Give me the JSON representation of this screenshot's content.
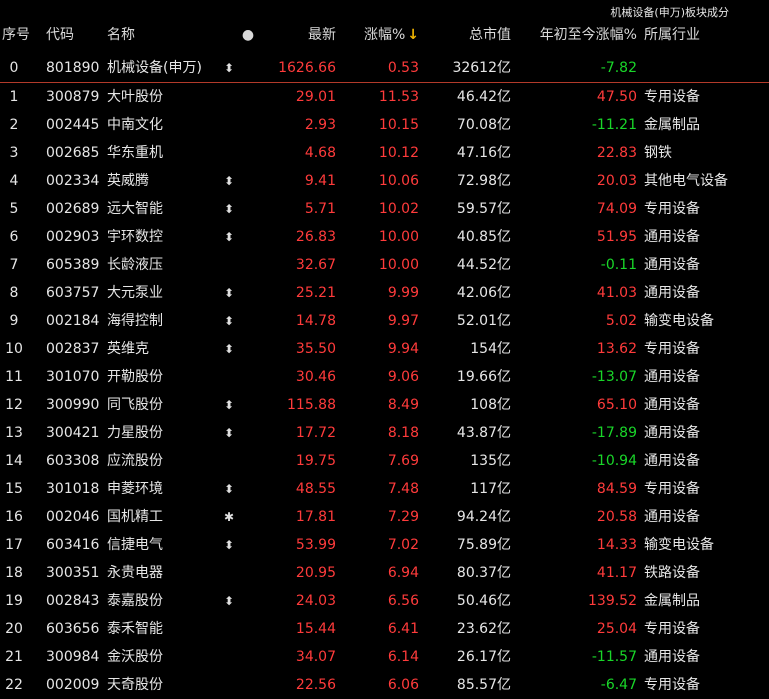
{
  "title": "机械设备(申万)板块成分",
  "header": {
    "seq": "序号",
    "code": "代码",
    "name": "名称",
    "dot": "●",
    "last": "最新",
    "chg": "涨幅%",
    "sort_arrow": "↓",
    "cap": "总市值",
    "ytd": "年初至今涨幅%",
    "industry": "所属行业"
  },
  "colors": {
    "up": "#ff3b3b",
    "down": "#19d629",
    "sort_arrow": "#f0b400",
    "index_divider": "#b33a2a"
  },
  "rows": [
    {
      "seq": "0",
      "code": "801890",
      "name": "机械设备(申万)",
      "flag": "⬍",
      "last": "1626.66",
      "chg": "0.53",
      "cap": "32612亿",
      "ytd": "-7.82",
      "industry": "",
      "last_dir": "up",
      "ytd_dir": "down",
      "is_index": true
    },
    {
      "seq": "1",
      "code": "300879",
      "name": "大叶股份",
      "flag": "",
      "last": "29.01",
      "chg": "11.53",
      "cap": "46.42亿",
      "ytd": "47.50",
      "industry": "专用设备",
      "last_dir": "up",
      "ytd_dir": "up"
    },
    {
      "seq": "2",
      "code": "002445",
      "name": "中南文化",
      "flag": "",
      "last": "2.93",
      "chg": "10.15",
      "cap": "70.08亿",
      "ytd": "-11.21",
      "industry": "金属制品",
      "last_dir": "up",
      "ytd_dir": "down"
    },
    {
      "seq": "3",
      "code": "002685",
      "name": "华东重机",
      "flag": "",
      "last": "4.68",
      "chg": "10.12",
      "cap": "47.16亿",
      "ytd": "22.83",
      "industry": "钢铁",
      "last_dir": "up",
      "ytd_dir": "up"
    },
    {
      "seq": "4",
      "code": "002334",
      "name": "英威腾",
      "flag": "⬍",
      "last": "9.41",
      "chg": "10.06",
      "cap": "72.98亿",
      "ytd": "20.03",
      "industry": "其他电气设备",
      "last_dir": "up",
      "ytd_dir": "up"
    },
    {
      "seq": "5",
      "code": "002689",
      "name": "远大智能",
      "flag": "⬍",
      "last": "5.71",
      "chg": "10.02",
      "cap": "59.57亿",
      "ytd": "74.09",
      "industry": "专用设备",
      "last_dir": "up",
      "ytd_dir": "up"
    },
    {
      "seq": "6",
      "code": "002903",
      "name": "宇环数控",
      "flag": "⬍",
      "last": "26.83",
      "chg": "10.00",
      "cap": "40.85亿",
      "ytd": "51.95",
      "industry": "通用设备",
      "last_dir": "up",
      "ytd_dir": "up"
    },
    {
      "seq": "7",
      "code": "605389",
      "name": "长龄液压",
      "flag": "",
      "last": "32.67",
      "chg": "10.00",
      "cap": "44.52亿",
      "ytd": "-0.11",
      "industry": "通用设备",
      "last_dir": "up",
      "ytd_dir": "down"
    },
    {
      "seq": "8",
      "code": "603757",
      "name": "大元泵业",
      "flag": "⬍",
      "last": "25.21",
      "chg": "9.99",
      "cap": "42.06亿",
      "ytd": "41.03",
      "industry": "通用设备",
      "last_dir": "up",
      "ytd_dir": "up"
    },
    {
      "seq": "9",
      "code": "002184",
      "name": "海得控制",
      "flag": "⬍",
      "last": "14.78",
      "chg": "9.97",
      "cap": "52.01亿",
      "ytd": "5.02",
      "industry": "输变电设备",
      "last_dir": "up",
      "ytd_dir": "up"
    },
    {
      "seq": "10",
      "code": "002837",
      "name": "英维克",
      "flag": "⬍",
      "last": "35.50",
      "chg": "9.94",
      "cap": "154亿",
      "ytd": "13.62",
      "industry": "专用设备",
      "last_dir": "up",
      "ytd_dir": "up"
    },
    {
      "seq": "11",
      "code": "301070",
      "name": "开勒股份",
      "flag": "",
      "last": "30.46",
      "chg": "9.06",
      "cap": "19.66亿",
      "ytd": "-13.07",
      "industry": "通用设备",
      "last_dir": "up",
      "ytd_dir": "down"
    },
    {
      "seq": "12",
      "code": "300990",
      "name": "同飞股份",
      "flag": "⬍",
      "last": "115.88",
      "chg": "8.49",
      "cap": "108亿",
      "ytd": "65.10",
      "industry": "通用设备",
      "last_dir": "up",
      "ytd_dir": "up"
    },
    {
      "seq": "13",
      "code": "300421",
      "name": "力星股份",
      "flag": "⬍",
      "last": "17.72",
      "chg": "8.18",
      "cap": "43.87亿",
      "ytd": "-17.89",
      "industry": "通用设备",
      "last_dir": "up",
      "ytd_dir": "down"
    },
    {
      "seq": "14",
      "code": "603308",
      "name": "应流股份",
      "flag": "",
      "last": "19.75",
      "chg": "7.69",
      "cap": "135亿",
      "ytd": "-10.94",
      "industry": "通用设备",
      "last_dir": "up",
      "ytd_dir": "down"
    },
    {
      "seq": "15",
      "code": "301018",
      "name": "申菱环境",
      "flag": "⬍",
      "last": "48.55",
      "chg": "7.48",
      "cap": "117亿",
      "ytd": "84.59",
      "industry": "专用设备",
      "last_dir": "up",
      "ytd_dir": "up"
    },
    {
      "seq": "16",
      "code": "002046",
      "name": "国机精工",
      "flag": "✱",
      "last": "17.81",
      "chg": "7.29",
      "cap": "94.24亿",
      "ytd": "20.58",
      "industry": "通用设备",
      "last_dir": "up",
      "ytd_dir": "up"
    },
    {
      "seq": "17",
      "code": "603416",
      "name": "信捷电气",
      "flag": "⬍",
      "last": "53.99",
      "chg": "7.02",
      "cap": "75.89亿",
      "ytd": "14.33",
      "industry": "输变电设备",
      "last_dir": "up",
      "ytd_dir": "up"
    },
    {
      "seq": "18",
      "code": "300351",
      "name": "永贵电器",
      "flag": "",
      "last": "20.95",
      "chg": "6.94",
      "cap": "80.37亿",
      "ytd": "41.17",
      "industry": "铁路设备",
      "last_dir": "up",
      "ytd_dir": "up"
    },
    {
      "seq": "19",
      "code": "002843",
      "name": "泰嘉股份",
      "flag": "⬍",
      "last": "24.03",
      "chg": "6.56",
      "cap": "50.46亿",
      "ytd": "139.52",
      "industry": "金属制品",
      "last_dir": "up",
      "ytd_dir": "up"
    },
    {
      "seq": "20",
      "code": "603656",
      "name": "泰禾智能",
      "flag": "",
      "last": "15.44",
      "chg": "6.41",
      "cap": "23.62亿",
      "ytd": "25.04",
      "industry": "专用设备",
      "last_dir": "up",
      "ytd_dir": "up"
    },
    {
      "seq": "21",
      "code": "300984",
      "name": "金沃股份",
      "flag": "",
      "last": "34.07",
      "chg": "6.14",
      "cap": "26.17亿",
      "ytd": "-11.57",
      "industry": "通用设备",
      "last_dir": "up",
      "ytd_dir": "down"
    },
    {
      "seq": "22",
      "code": "002009",
      "name": "天奇股份",
      "flag": "",
      "last": "22.56",
      "chg": "6.06",
      "cap": "85.57亿",
      "ytd": "-6.47",
      "industry": "专用设备",
      "last_dir": "up",
      "ytd_dir": "down"
    }
  ]
}
